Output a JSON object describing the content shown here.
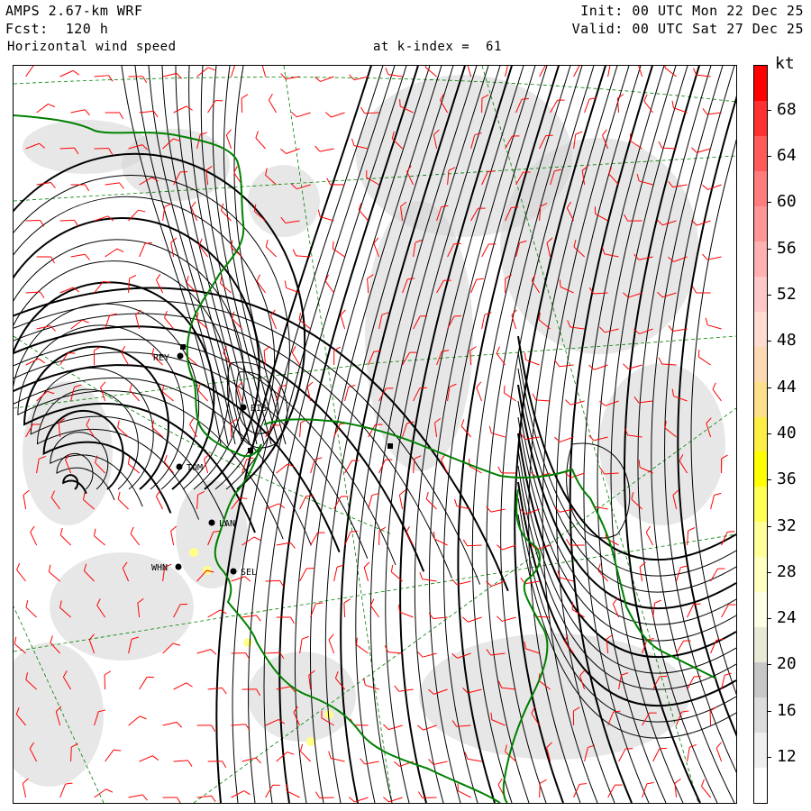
{
  "header": {
    "model": "AMPS 2.67-km WRF",
    "fcst_label": "Fcst:",
    "fcst_value": "120 h",
    "field": "Horizontal wind speed",
    "init_label": "Init:",
    "init_value": "00 UTC Mon 22 Dec 25",
    "valid_label": "Valid:",
    "valid_value": "00 UTC Sat 27 Dec 25",
    "level_label": "at k-index =",
    "level_value": "61"
  },
  "colorbar": {
    "unit": "kt",
    "labels": [
      "12",
      "16",
      "20",
      "24",
      "28",
      "32",
      "36",
      "40",
      "44",
      "48",
      "52",
      "56",
      "60",
      "64",
      "68"
    ],
    "colors": [
      "#ffffff",
      "#efefef",
      "#dcdcdc",
      "#c8c8c8",
      "#e9e9d6",
      "#ffffe6",
      "#ffffc2",
      "#ffff99",
      "#ffff55",
      "#ffff00",
      "#ffee44",
      "#ffe08a",
      "#ffd9b3",
      "#ffdcd2",
      "#ffc8c8",
      "#ffb0b0",
      "#ff9696",
      "#ff7c7c",
      "#ff5a5a",
      "#ff3030",
      "#ff0000"
    ]
  },
  "stations": [
    {
      "id": "REY",
      "label": "REY"
    },
    {
      "id": "BIS",
      "label": "BIS"
    },
    {
      "id": "TOM",
      "label": "TOM"
    },
    {
      "id": "LAN",
      "label": "LAN"
    },
    {
      "id": "WHN",
      "label": "WHN"
    },
    {
      "id": "SEL",
      "label": "SEL"
    }
  ],
  "colors": {
    "coastline": "#008000",
    "graticule": "#008000",
    "barbs": "#ff0000",
    "streamlines": "#000000",
    "terrain_shade": "#d4d4d4"
  }
}
